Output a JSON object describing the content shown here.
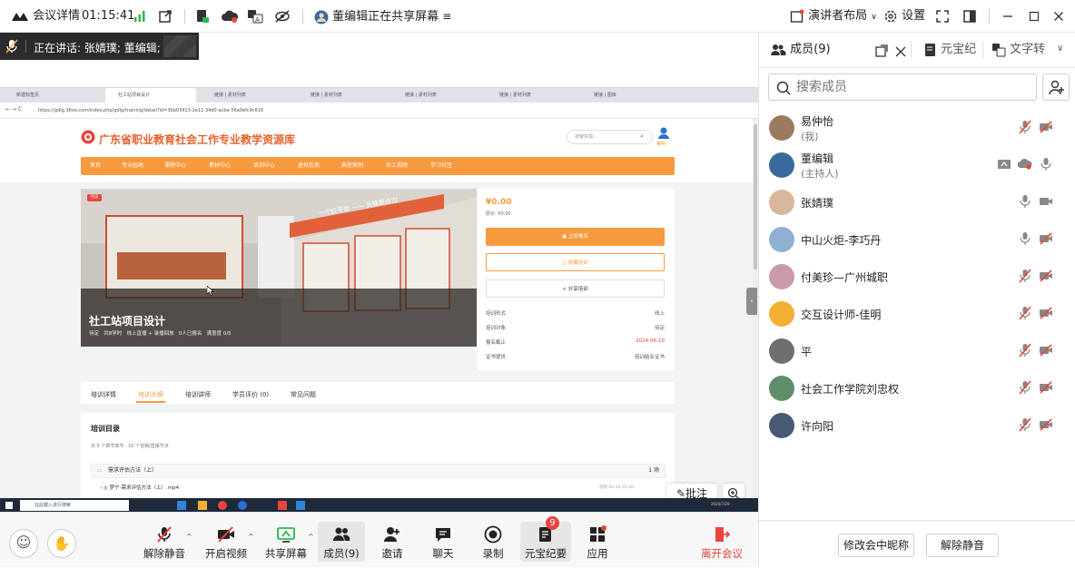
{
  "topbar": {
    "meeting_label": "会议详情",
    "time": "01:15:41",
    "sharing_text": "董编辑正在共享屏幕",
    "layout_label": "演讲者布局",
    "settings_label": "设置"
  },
  "speaking": {
    "text": "正在讲话: 张婧璞; 董编辑;"
  },
  "shared_screen": {
    "browser_tabs": [
      "新建标签页",
      "社工站项目设计",
      "链接 | 素材列表",
      "链接 | 素材列表",
      "链接 | 素材列表",
      "链接 | 素材列表",
      "链接 | 图库"
    ],
    "url": "https://gdlg.36ve.com/index.php/gdlg/training/detail?id=3bb03413-2e11-34d0-acba-56a0efc9c616",
    "site_title": "广东省职业教育社会工作专业教学资源库",
    "site_search_placeholder": "搜索资源...",
    "user_name": "董明",
    "nav": [
      "首页",
      "专业园地",
      "课程中心",
      "素材中心",
      "培训中心",
      "虚拟仿真",
      "典型案例",
      "社工视频",
      "学习社区"
    ],
    "hero_badge": "热议",
    "hero_title": "社工站项目设计",
    "hero_meta": "待定   共8学时   线上直播 + 录播回放   0人已报名   满意度 0/5",
    "hero_slogan": "一个红平台 —— 先锋聚合力",
    "price": "¥0.00",
    "orig_price": "原价: ¥0.00",
    "btn_enroll": "立即报名",
    "btn_favorite": "收藏培训",
    "btn_share": "分享培训",
    "info": [
      {
        "k": "培训形式",
        "v": "线上"
      },
      {
        "k": "培训对象",
        "v": "待定"
      },
      {
        "k": "报名截止",
        "v": "2024-06-10"
      },
      {
        "k": "证书提供",
        "v": "培训结业证书"
      }
    ],
    "detail_tabs": [
      "培训详情",
      "培训大纲",
      "培训讲师",
      "学员评价 (0)",
      "常见问题"
    ],
    "toc_title": "培训目录",
    "toc_summary": "共 5 个章节章节 · 10 个音频/直播节点",
    "toc_rows": [
      {
        "label": "需求评估方法（上）",
        "right": "1 场"
      },
      {
        "label": "梦宁-需求评估方法（上）.mp4",
        "right": "视频 00:46:35:40"
      }
    ],
    "taskbar_search": "在此键入进行搜索",
    "taskbar_date": "2024/7/29"
  },
  "annotate_label": "批注",
  "toolbar": {
    "items": [
      {
        "label": "解除静音"
      },
      {
        "label": "开启视频"
      },
      {
        "label": "共享屏幕"
      },
      {
        "label": "成员(9)"
      },
      {
        "label": "邀请"
      },
      {
        "label": "聊天"
      },
      {
        "label": "录制"
      },
      {
        "label": "元宝纪要"
      },
      {
        "label": "应用"
      }
    ],
    "badge_count": "9",
    "leave_label": "离开会议"
  },
  "panel": {
    "tab_members": "成员(9)",
    "tab_yuanbao": "元宝纪",
    "tab_text": "文字转",
    "search_placeholder": "搜索成员",
    "members": [
      {
        "name": "易仲怡",
        "sub": "(我)",
        "mic": "mic-muted-icon",
        "cam": "camera-off-icon"
      },
      {
        "name": "董编辑",
        "sub": "(主持人)",
        "mic": "mic-icon",
        "cam": "screen-share-icon"
      },
      {
        "name": "张婧璞",
        "sub": "",
        "mic": "mic-icon",
        "cam": "camera-icon"
      },
      {
        "name": "中山火炬-李巧丹",
        "sub": "",
        "mic": "mic-icon",
        "cam": "camera-off-icon"
      },
      {
        "name": "付美珍—广州城职",
        "sub": "",
        "mic": "mic-muted-icon",
        "cam": "camera-off-icon"
      },
      {
        "name": "交互设计师-佳明",
        "sub": "",
        "mic": "mic-muted-icon",
        "cam": "camera-off-icon"
      },
      {
        "name": "平",
        "sub": "",
        "mic": "mic-muted-icon",
        "cam": "camera-off-icon"
      },
      {
        "name": "社会工作学院刘忠权",
        "sub": "",
        "mic": "mic-muted-icon",
        "cam": "camera-off-icon"
      },
      {
        "name": "许向阳",
        "sub": "",
        "mic": "mic-muted-icon",
        "cam": "camera-off-icon"
      }
    ],
    "btn_rename": "修改会中昵称",
    "btn_unmute": "解除静音"
  },
  "colors": {
    "accent_orange": "#f79a3e",
    "muted_red": "#e8453c",
    "leave_red": "#e8453c",
    "signal_green": "#2db84d"
  }
}
